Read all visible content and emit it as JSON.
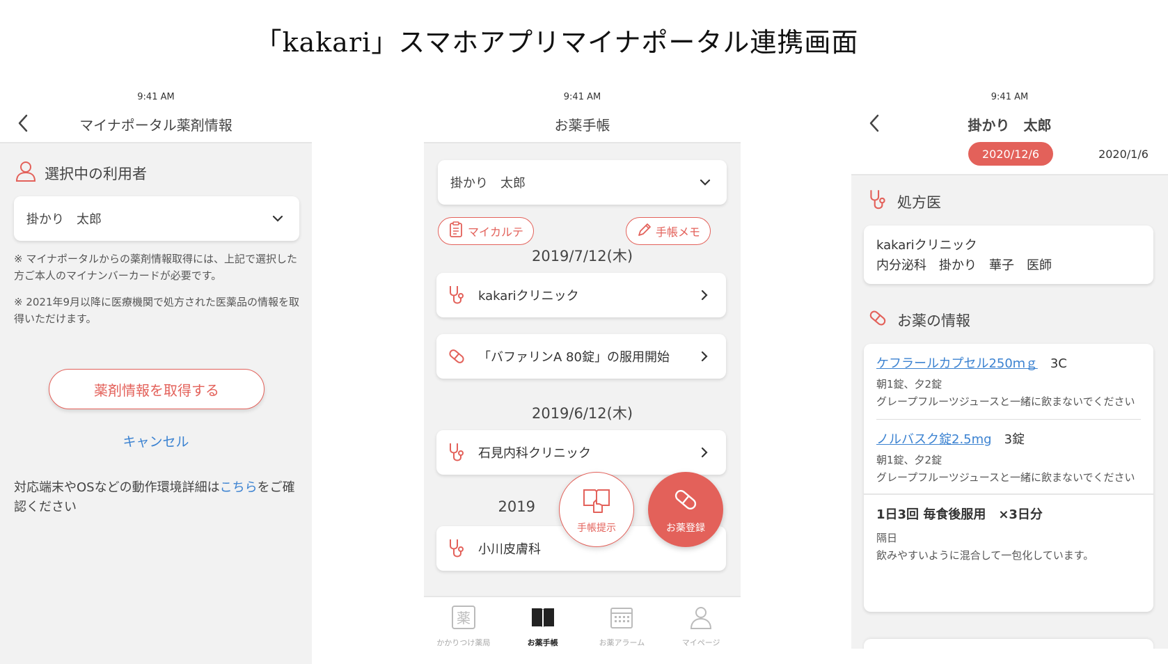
{
  "page_title": "「kakari」スマホアプリマイナポータル連携画面",
  "screen_a": {
    "status_time": "9:41 AM",
    "title": "マイナポータル薬剤情報",
    "section_user": "選択中の利用者",
    "selected_user": "掛かり　太郎",
    "note1": "※ マイナポータルからの薬剤情報取得には、上記で選択した方ご本人のマイナンバーカードが必要です。",
    "note2": "※ 2021年9月以降に医療機関で処方された医薬品の情報を取得いただけます。",
    "fetch_button": "薬剤情報を取得する",
    "cancel_link": "キャンセル",
    "env_prefix": "対応端末やOSなどの動作環境詳細は",
    "env_link": "こちら",
    "env_suffix": "をご確認ください"
  },
  "screen_b": {
    "status_time": "9:41 AM",
    "title": "お薬手帳",
    "selected_user": "掛かり　太郎",
    "pill_karte": "マイカルテ",
    "pill_memo": "手帳メモ",
    "groups": [
      {
        "date": "2019/7/12(木)",
        "items": [
          "kakariクリニック",
          "「バファリンA 80錠」の服用開始"
        ]
      },
      {
        "date": "2019/6/12(木)",
        "items": [
          "石見内科クリニック"
        ]
      },
      {
        "date": "2019",
        "items": [
          "小川皮膚科"
        ]
      }
    ],
    "fab_book": "手帳提示",
    "fab_med": "お薬登録",
    "tabs": [
      "かかりつけ薬局",
      "お薬手帳",
      "お薬アラーム",
      "マイページ"
    ],
    "active_tab": "お薬手帳"
  },
  "screen_c": {
    "status_time": "9:41 AM",
    "title": "掛かり　太郎",
    "dates": [
      "2020/12/6",
      "2020/1/6"
    ],
    "section_doctor": "処方医",
    "clinic": "kakariクリニック",
    "doctor": "内分泌科　掛かり　華子　医師",
    "section_med": "お薬の情報",
    "meds": [
      {
        "name": "ケフラールカプセル250ｍｇ",
        "qty": "3C",
        "dose": "朝1錠、夕2錠",
        "note": "グレープフルーツジュースと一緒に飲まないでください"
      },
      {
        "name": "ノルバスク錠2.5mg",
        "qty": "3錠",
        "dose": "朝1錠、夕2錠",
        "note": "グレープフルーツジュースと一緒に飲まないでください"
      }
    ],
    "usage_title": "1日3回 毎食後服用　×3日分",
    "usage_sub1": "隔日",
    "usage_sub2": "飲みやすいように混合して一包化しています。"
  },
  "colors": {
    "accent": "#e3615a",
    "link": "#3b82d1",
    "background": "#f2f2f2"
  }
}
